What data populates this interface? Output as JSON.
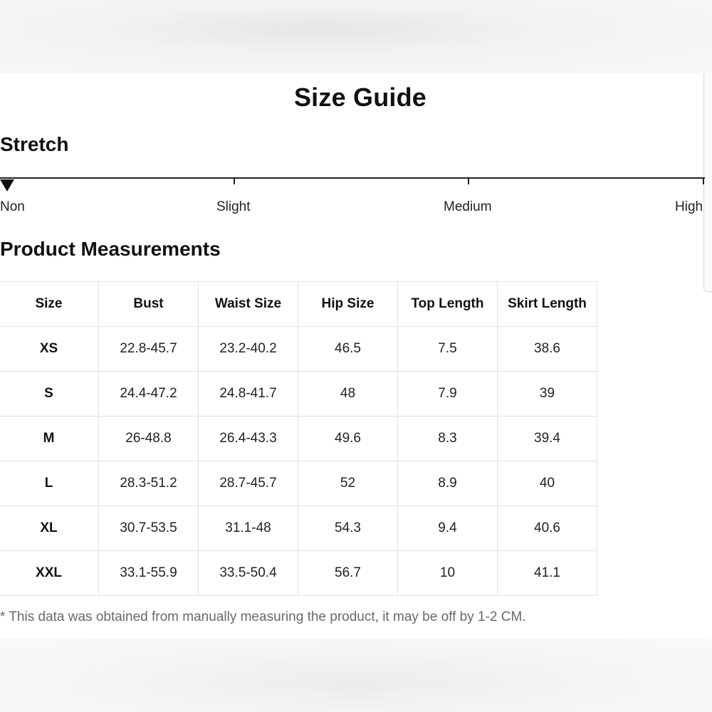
{
  "title": "Size Guide",
  "stretch": {
    "heading": "Stretch",
    "levels": [
      "Non",
      "Slight",
      "Medium",
      "High"
    ],
    "selected": "Non"
  },
  "measurements": {
    "heading": "Product Measurements",
    "columns": [
      "Size",
      "Bust",
      "Waist Size",
      "Hip Size",
      "Top Length",
      "Skirt Length"
    ],
    "rows": [
      [
        "XS",
        "22.8-45.7",
        "23.2-40.2",
        "46.5",
        "7.5",
        "38.6"
      ],
      [
        "S",
        "24.4-47.2",
        "24.8-41.7",
        "48",
        "7.9",
        "39"
      ],
      [
        "M",
        "26-48.8",
        "26.4-43.3",
        "49.6",
        "8.3",
        "39.4"
      ],
      [
        "L",
        "28.3-51.2",
        "28.7-45.7",
        "52",
        "8.9",
        "40"
      ],
      [
        "XL",
        "30.7-53.5",
        "31.1-48",
        "54.3",
        "9.4",
        "40.6"
      ],
      [
        "XXL",
        "33.1-55.9",
        "33.5-50.4",
        "56.7",
        "10",
        "41.1"
      ]
    ]
  },
  "footnote": "* This data was obtained from manually measuring the product, it may be off by 1-2 CM."
}
